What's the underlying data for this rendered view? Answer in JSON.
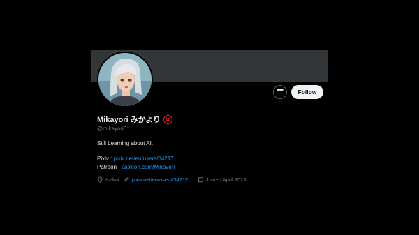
{
  "profile": {
    "display_name": "Mikayori みかより",
    "age_badge": "18",
    "handle": "@mikayori01",
    "bio": "Still Learning about AI.",
    "pixiv_label": "Pixiv : ",
    "pixiv_url": "pixiv.net/en/users/34217…",
    "patreon_label": "Patreon : ",
    "patreon_url": "patreon.com/Mikayori",
    "location": "Isekai",
    "website": "pixiv.net/en/users/34217…",
    "joined": "Joined April 2023"
  },
  "actions": {
    "more_label": "•••",
    "follow_label": "Follow"
  },
  "colors": {
    "background": "#000000",
    "banner": "#333639",
    "link": "#1d9bf0",
    "muted": "#71767b",
    "follow_bg": "#eff3f4",
    "badge": "#f4212e"
  },
  "icons": {
    "location": "location-pin-icon",
    "website": "link-icon",
    "joined": "calendar-icon"
  }
}
